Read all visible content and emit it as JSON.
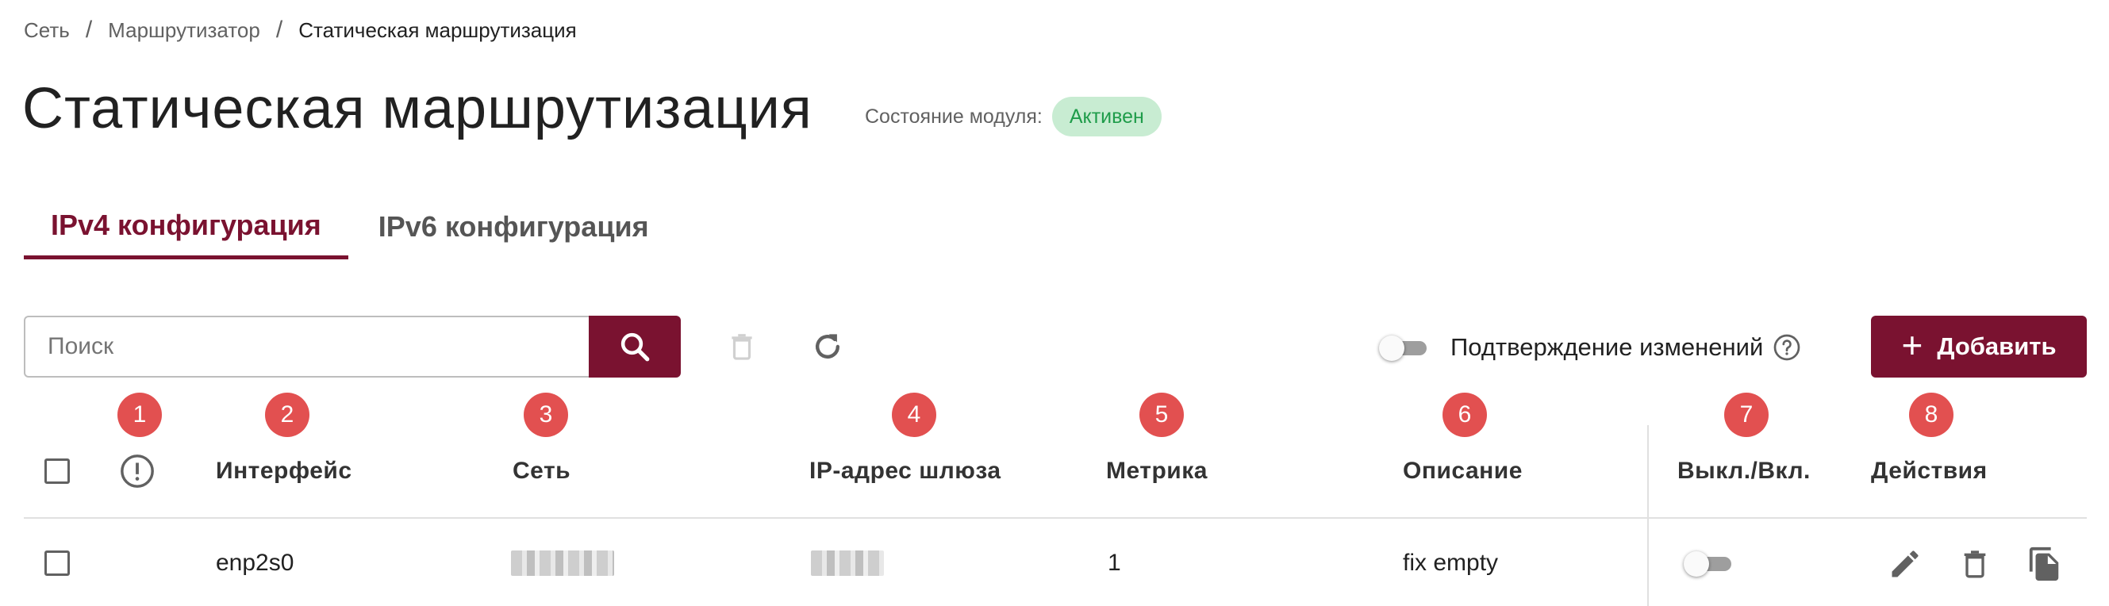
{
  "breadcrumb": {
    "items": [
      "Сеть",
      "Маршрутизатор",
      "Статическая маршрутизация"
    ],
    "separator": "/"
  },
  "page": {
    "title": "Статическая маршрутизация",
    "module_state_label": "Состояние модуля:",
    "module_state_value": "Активен"
  },
  "tabs": [
    {
      "label": "IPv4 конфигурация",
      "active": true
    },
    {
      "label": "IPv6 конфигурация",
      "active": false
    }
  ],
  "toolbar": {
    "search_placeholder": "Поиск",
    "confirm_changes_label": "Подтверждение изменений",
    "confirm_changes_enabled": false,
    "add_label": "Добавить"
  },
  "table": {
    "column_numbers": [
      "1",
      "2",
      "3",
      "4",
      "5",
      "6",
      "7",
      "8"
    ],
    "headers": {
      "interface": "Интерфейс",
      "network": "Сеть",
      "gateway": "IP-адрес шлюза",
      "metric": "Метрика",
      "description": "Описание",
      "enabled": "Выкл./Вкл.",
      "actions": "Действия"
    },
    "rows": [
      {
        "interface": "enp2s0",
        "metric": "1",
        "description": "fix empty",
        "enabled": false
      }
    ]
  },
  "colors": {
    "primary": "#7a1230",
    "badge_bg": "#c8ecd2",
    "badge_text": "#1f9c4a",
    "marker": "#e25050"
  },
  "icons": [
    "search-icon",
    "trash-icon",
    "refresh-icon",
    "help-icon",
    "plus-icon",
    "warning-icon",
    "edit-icon",
    "delete-icon",
    "copy-icon"
  ]
}
